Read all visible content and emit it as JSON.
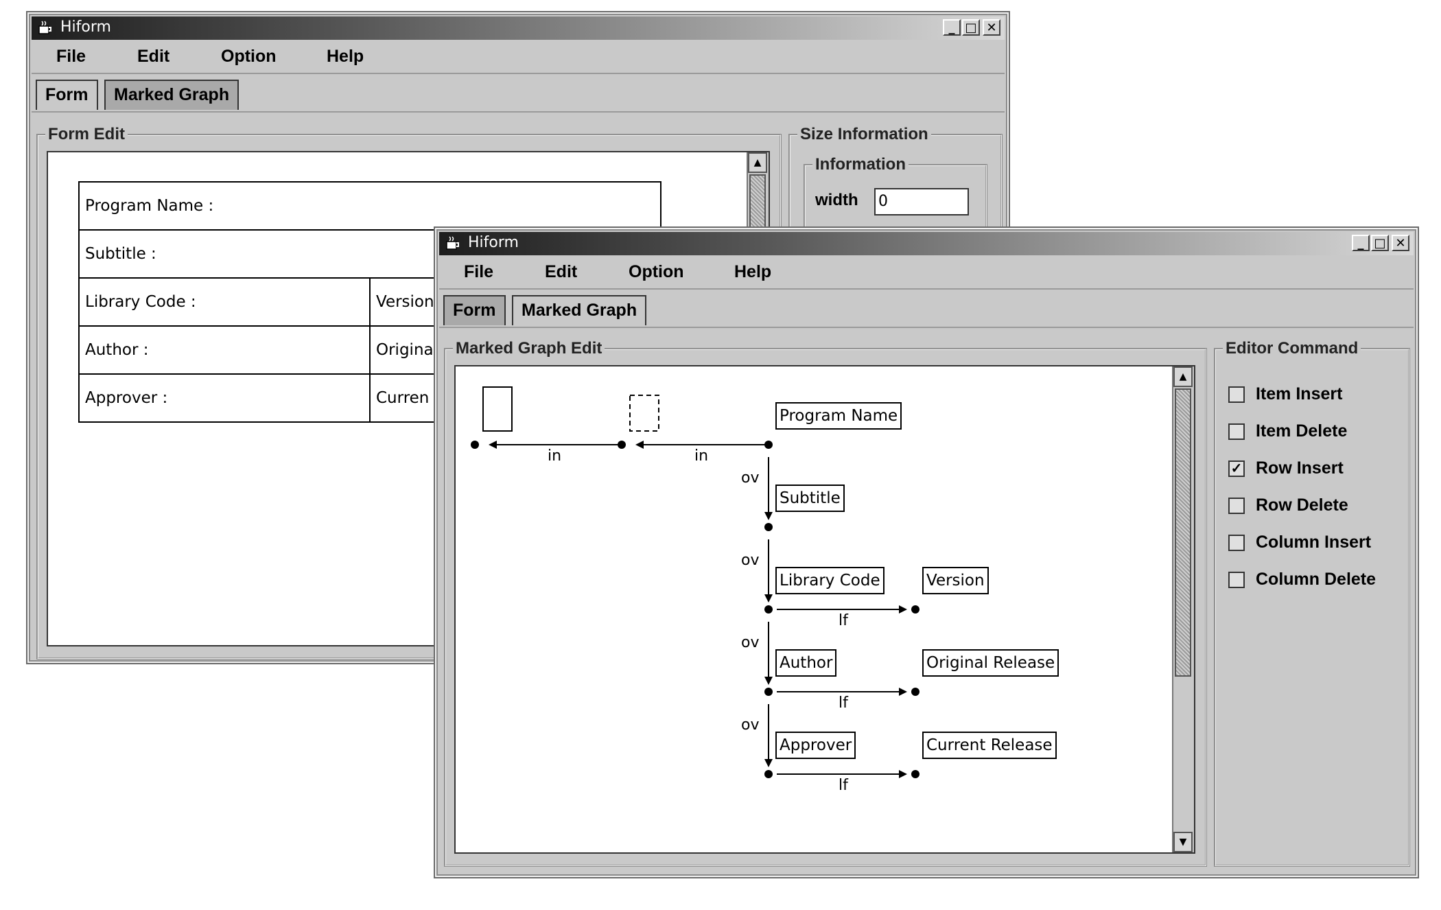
{
  "back_window": {
    "title": "Hiform",
    "menu": [
      "File",
      "Edit",
      "Option",
      "Help"
    ],
    "tabs": [
      "Form",
      "Marked Graph"
    ],
    "form_edit": {
      "title": "Form Edit",
      "rows": [
        [
          "Program Name :"
        ],
        [
          "Subtitle :"
        ],
        [
          "Library Code :",
          "Version"
        ],
        [
          "Author :",
          "Origina"
        ],
        [
          "Approver :",
          "Curren"
        ]
      ]
    },
    "size_info": {
      "title": "Size Information",
      "sub_title": "Information",
      "width_label": "width",
      "width_value": "0"
    }
  },
  "front_window": {
    "title": "Hiform",
    "menu": [
      "File",
      "Edit",
      "Option",
      "Help"
    ],
    "tabs": [
      "Form",
      "Marked Graph"
    ],
    "graph": {
      "title": "Marked Graph Edit",
      "nodes": {
        "program_name": "Program Name",
        "subtitle": "Subtitle",
        "library_code": "Library Code",
        "version": "Version",
        "author": "Author",
        "original_release": "Original Release",
        "approver": "Approver",
        "current_release": "Current Release"
      },
      "edge_labels": {
        "in1": "in",
        "in2": "in",
        "ov1": "ov",
        "ov2": "ov",
        "ov3": "ov",
        "ov4": "ov",
        "lf1": "lf",
        "lf2": "lf",
        "lf3": "lf"
      }
    },
    "editor_command": {
      "title": "Editor Command",
      "items": [
        {
          "label": "Item Insert",
          "checked": false
        },
        {
          "label": "Item Delete",
          "checked": false
        },
        {
          "label": "Row Insert",
          "checked": true
        },
        {
          "label": "Row Delete",
          "checked": false
        },
        {
          "label": "Column Insert",
          "checked": false
        },
        {
          "label": "Column Delete",
          "checked": false
        }
      ]
    }
  }
}
